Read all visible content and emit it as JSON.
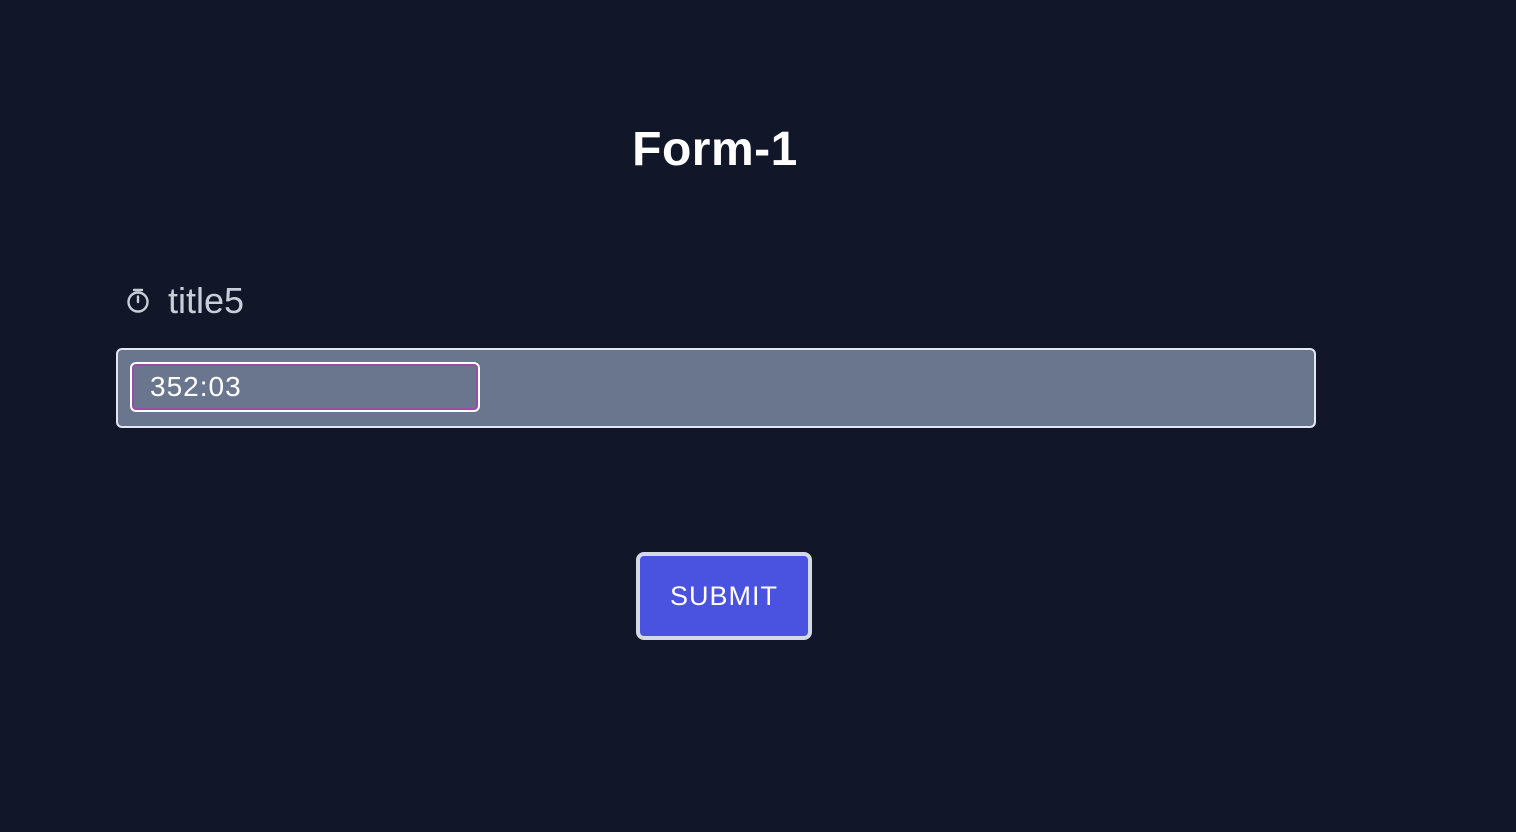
{
  "form": {
    "title": "Form-1",
    "field": {
      "icon": "timer-icon",
      "label": "title5",
      "value": "352:03"
    },
    "submit_label": "SUBMIT"
  },
  "colors": {
    "background": "#111729",
    "field_box": "#6a768d",
    "submit_button": "#4a52e0",
    "input_focus_ring": "#9a4ba6"
  }
}
